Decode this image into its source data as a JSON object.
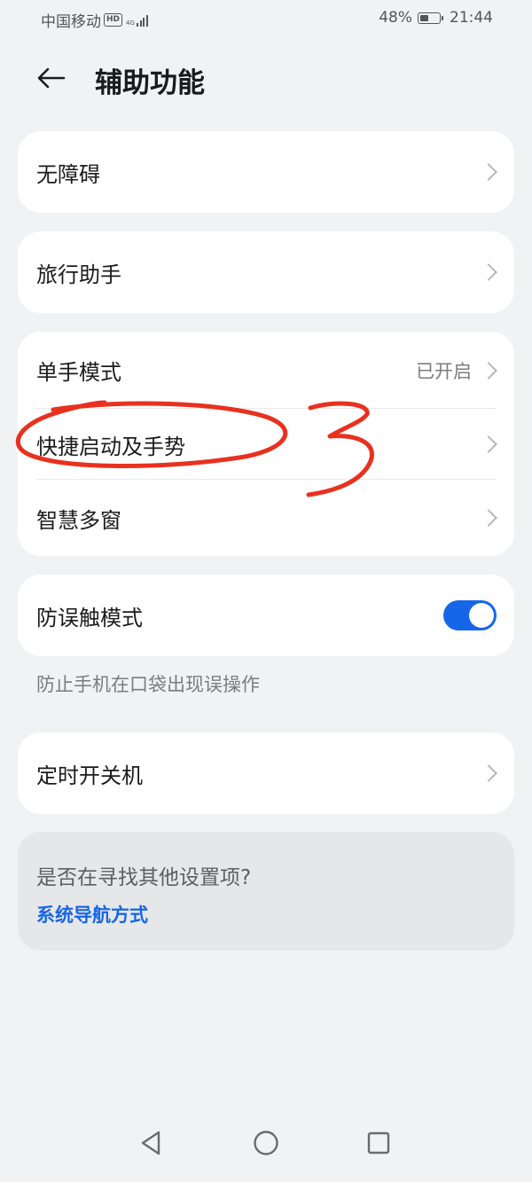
{
  "status_bar": {
    "carrier": "中国移动",
    "hd_label": "HD",
    "network": "4G",
    "battery_percent": "48%",
    "battery_level": 0.48,
    "time": "21:44"
  },
  "header": {
    "back_icon": "arrow-left-icon",
    "title": "辅助功能"
  },
  "groups": {
    "accessibility": {
      "label": "无障碍"
    },
    "travel_assistant": {
      "label": "旅行助手"
    },
    "one_hand_mode": {
      "label": "单手模式",
      "value": "已开启"
    },
    "shortcuts_gestures": {
      "label": "快捷启动及手势"
    },
    "smart_multiwindow": {
      "label": "智慧多窗"
    },
    "pocket_mode": {
      "label": "防误触模式",
      "enabled": true,
      "description": "防止手机在口袋出现误操作"
    },
    "scheduled_power": {
      "label": "定时开关机"
    }
  },
  "suggestion": {
    "question": "是否在寻找其他设置项?",
    "link": "系统导航方式"
  },
  "annotation": {
    "handwritten_number": "3",
    "color": "#e8311e"
  },
  "nav_bar": {
    "back_icon": "triangle-back-icon",
    "home_icon": "circle-home-icon",
    "recents_icon": "square-recents-icon"
  },
  "colors": {
    "accent": "#1766e8",
    "background": "#f1f2f4",
    "card": "#ffffff"
  }
}
